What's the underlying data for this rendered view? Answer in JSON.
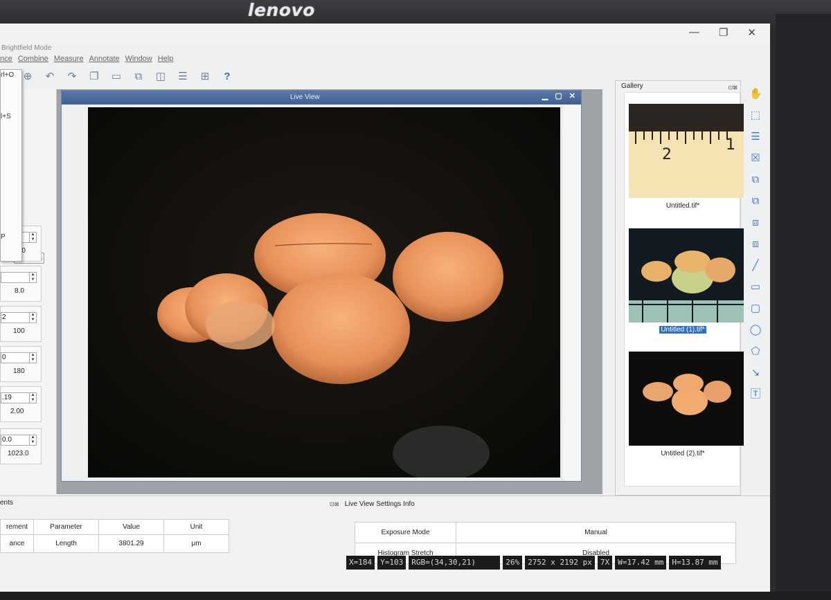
{
  "monitor": {
    "brand": "lenovo"
  },
  "window": {
    "title": "Brightfield Mode",
    "controls": [
      "—",
      "❐",
      "✕"
    ]
  },
  "menu": [
    "nce",
    "Combine",
    "Measure",
    "Annotate",
    "Window",
    "Help"
  ],
  "left_panel": {
    "popup_items": [
      "rl+O",
      "l+S",
      "P"
    ],
    "controls_button": "ontrols",
    "params": [
      {
        "value": "",
        "sub": ".00"
      },
      {
        "value": "",
        "sub": "8.0"
      },
      {
        "value": "2",
        "sub": "100"
      },
      {
        "value": "0",
        "sub": "180"
      },
      {
        "value": ".19",
        "sub": "2.00"
      },
      {
        "value": "0.0",
        "sub": "1023.0"
      }
    ]
  },
  "live_view": {
    "title": "Live View"
  },
  "gallery": {
    "title": "Gallery",
    "items": [
      {
        "caption": "Untitled.tif*",
        "selected": false
      },
      {
        "caption": "Untitled (1).tif*",
        "selected": true
      },
      {
        "caption": "Untitled (2).tif*",
        "selected": false
      }
    ],
    "ruler_labels": [
      "2",
      "1"
    ]
  },
  "measurements": {
    "title": "ents",
    "headers": [
      "rement",
      "Parameter",
      "Value",
      "Unit"
    ],
    "rows": [
      [
        "ance",
        "Length",
        "3801.29",
        "μm"
      ]
    ]
  },
  "live_view_settings": {
    "title": "Live View Settings Info",
    "rows": [
      {
        "label": "Exposure Mode",
        "value": "Manual"
      },
      {
        "label": "Histogram Stretch",
        "value": "Disabled"
      }
    ]
  },
  "status_bar": {
    "x": "X=184",
    "y": "Y=103",
    "rgb": "RGB=(34,30,21)",
    "zoom": "26%",
    "size": "2752 x 2192 px",
    "mag": "7X",
    "width": "W=17.42 mm",
    "height": "H=13.87 mm"
  }
}
